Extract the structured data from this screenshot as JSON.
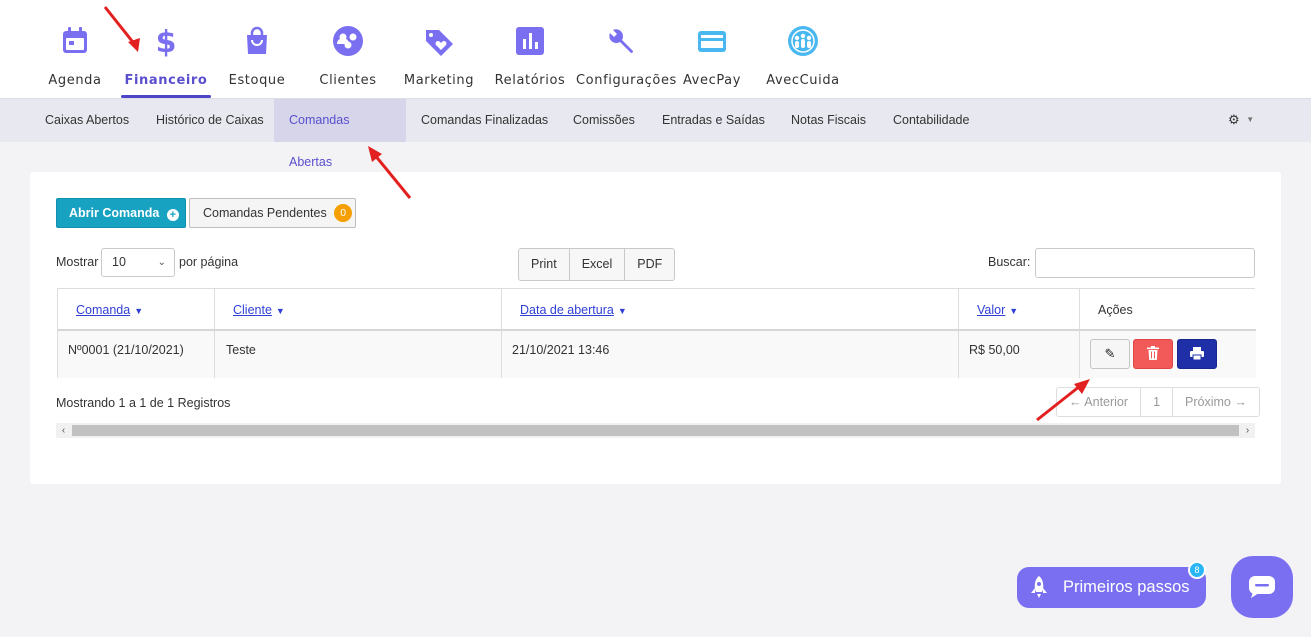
{
  "top_nav": {
    "items": [
      {
        "label": "Agenda",
        "icon": "calendar-icon"
      },
      {
        "label": "Financeiro",
        "icon": "dollar-icon",
        "active": true
      },
      {
        "label": "Estoque",
        "icon": "shopping-bag-icon"
      },
      {
        "label": "Clientes",
        "icon": "users-icon"
      },
      {
        "label": "Marketing",
        "icon": "tag-heart-icon"
      },
      {
        "label": "Relatórios",
        "icon": "bar-chart-icon"
      },
      {
        "label": "Configurações",
        "icon": "wrench-icon"
      },
      {
        "label": "AvecPay",
        "icon": "credit-card-icon"
      },
      {
        "label": "AvecCuida",
        "icon": "people-globe-icon"
      }
    ],
    "accent_color": "#5a4fcf"
  },
  "sub_nav": {
    "items": [
      {
        "label": "Caixas Abertos"
      },
      {
        "label": "Histórico de Caixas"
      },
      {
        "label": "Comandas Abertas",
        "active": true
      },
      {
        "label": "Comandas Finalizadas"
      },
      {
        "label": "Comissões"
      },
      {
        "label": "Entradas e Saídas"
      },
      {
        "label": "Notas Fiscais"
      },
      {
        "label": "Contabilidade"
      }
    ],
    "settings_icon": "gear-icon"
  },
  "toolbar": {
    "abrir_label": "Abrir Comanda",
    "pendentes_label": "Comandas Pendentes",
    "pendentes_count": "0"
  },
  "table_controls": {
    "show_label": "Mostrar",
    "page_size": "10",
    "per_page_label": "por página",
    "export_buttons": [
      "Print",
      "Excel",
      "PDF"
    ],
    "search_label": "Buscar:",
    "search_value": ""
  },
  "table": {
    "columns": [
      "Comanda",
      "Cliente",
      "Data de abertura",
      "Valor",
      "Ações"
    ],
    "rows": [
      {
        "comanda": "Nº0001 (21/10/2021)",
        "cliente": "Teste",
        "data": "21/10/2021 13:46",
        "valor": "R$ 50,00"
      }
    ]
  },
  "footer_table": {
    "info": "Mostrando 1 a 1 de 1 Registros",
    "prev": "← Anterior",
    "page": "1",
    "next": "Próximo →"
  },
  "floating": {
    "primeiros_label": "Primeiros passos",
    "primeiros_badge": "8",
    "chat_icon": "chat-icon"
  },
  "colors": {
    "abrir_button": "#17a2c2",
    "pendentes_badge": "#f5a000",
    "delete_button": "#f25a5a",
    "print_button": "#1f2fa8",
    "annotation_arrow": "#e32020"
  }
}
